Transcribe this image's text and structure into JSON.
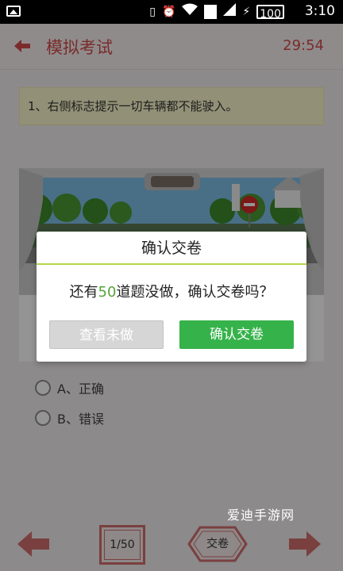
{
  "status_bar": {
    "time": "3:10",
    "sim_slot": "2",
    "battery": "100",
    "icons": [
      "picture-icon",
      "vibrate-icon",
      "alarm-icon",
      "wifi-icon",
      "signal-icon",
      "charging-icon"
    ]
  },
  "header": {
    "title": "模拟考试",
    "timer": "29:54"
  },
  "question": {
    "text": "1、右侧标志提示一切车辆都不能驶入。"
  },
  "options": [
    {
      "label": "A、正确"
    },
    {
      "label": "B、错误"
    }
  ],
  "dialog": {
    "title": "确认交卷",
    "message_prefix": "还有",
    "remaining_count": "50",
    "message_suffix": "道题没做，确认交卷吗？",
    "view_button": "查看未做",
    "confirm_button": "确认交卷"
  },
  "bottom_nav": {
    "page_indicator": "1/50",
    "submit_label": "交卷"
  },
  "watermark": "爱迪手游网",
  "colors": {
    "accent_red": "#d44a4a",
    "confirm_green": "#36b24a",
    "divider_green": "#b3d64a",
    "count_green": "#55a43a"
  }
}
